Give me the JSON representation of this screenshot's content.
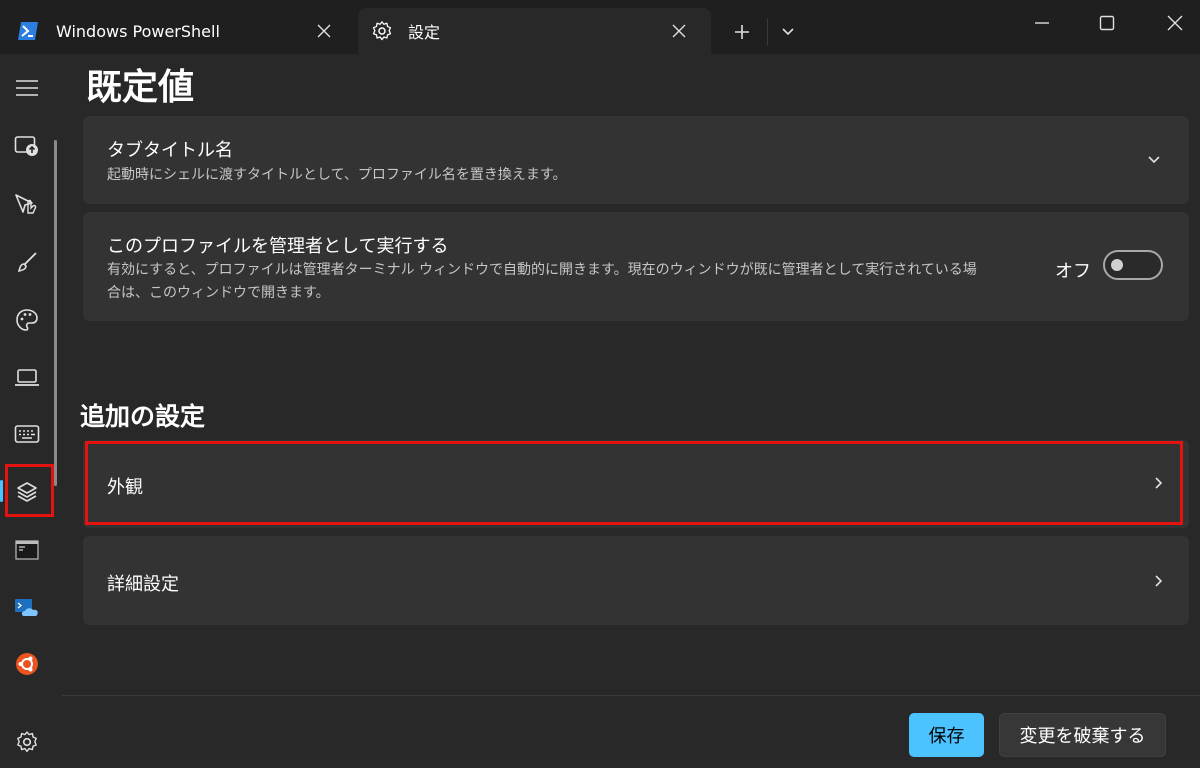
{
  "colors": {
    "accent": "#4cc2ff",
    "highlight_box": "#e3140f",
    "ubuntu_orange": "#e95420"
  },
  "tabs": [
    {
      "label": "Windows PowerShell",
      "icon": "powershell-icon"
    },
    {
      "label": "設定",
      "icon": "gear-icon",
      "active": true
    }
  ],
  "window_controls": [
    "minimize-icon",
    "maximize-icon",
    "close-icon"
  ],
  "sidebar": {
    "items": [
      {
        "icon": "hamburger-menu-icon"
      },
      {
        "icon": "startup-icon"
      },
      {
        "icon": "interaction-icon"
      },
      {
        "icon": "appearance-brush-icon"
      },
      {
        "icon": "color-palette-icon"
      },
      {
        "icon": "rendering-laptop-icon"
      },
      {
        "icon": "keyboard-icon"
      },
      {
        "icon": "profile-defaults-layers-icon",
        "selected": true
      },
      {
        "icon": "command-prompt-icon"
      },
      {
        "icon": "azure-cloud-shell-icon"
      },
      {
        "icon": "ubuntu-icon"
      },
      {
        "icon": "settings-gear-icon"
      }
    ]
  },
  "page": {
    "title": "既定値"
  },
  "settings": {
    "tab_title": {
      "title": "タブタイトル名",
      "description": "起動時にシェルに渡すタイトルとして、プロファイル名を置き換えます。"
    },
    "run_as_admin": {
      "title": "このプロファイルを管理者として実行する",
      "description_line1": "有効にすると、プロファイルは管理者ターミナル ウィンドウで自動的に開きます。現在のウィンドウが既に管理者として実行されている場",
      "description_line2": "合は、このウィンドウで開きます。",
      "toggle_label": "オフ",
      "toggle_on": false
    }
  },
  "additional": {
    "heading": "追加の設定",
    "items": [
      {
        "label": "外観",
        "highlighted": true
      },
      {
        "label": "詳細設定"
      }
    ]
  },
  "footer": {
    "save_label": "保存",
    "discard_label": "変更を破棄する"
  }
}
